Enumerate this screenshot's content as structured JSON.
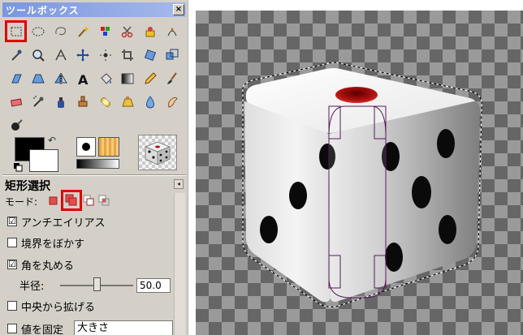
{
  "toolbox": {
    "title": "ツールボックス",
    "close_label": "×",
    "tools": [
      {
        "name": "rect-select-tool-icon",
        "selected": true
      },
      {
        "name": "ellipse-select-tool-icon"
      },
      {
        "name": "free-select-tool-icon"
      },
      {
        "name": "fuzzy-select-tool-icon"
      },
      {
        "name": "color-select-tool-icon"
      },
      {
        "name": "scissors-select-tool-icon"
      },
      {
        "name": "foreground-select-tool-icon"
      },
      {
        "name": "paths-tool-icon"
      },
      {
        "name": "color-picker-tool-icon"
      },
      {
        "name": "zoom-tool-icon"
      },
      {
        "name": "measure-tool-icon"
      },
      {
        "name": "move-tool-icon"
      },
      {
        "name": "align-tool-icon"
      },
      {
        "name": "crop-tool-icon"
      },
      {
        "name": "rotate-tool-icon"
      },
      {
        "name": "scale-tool-icon"
      },
      {
        "name": "shear-tool-icon"
      },
      {
        "name": "perspective-tool-icon"
      },
      {
        "name": "flip-tool-icon"
      },
      {
        "name": "text-tool-icon"
      },
      {
        "name": "bucket-fill-tool-icon"
      },
      {
        "name": "blend-tool-icon"
      },
      {
        "name": "pencil-tool-icon"
      },
      {
        "name": "paintbrush-tool-icon"
      },
      {
        "name": "eraser-tool-icon"
      },
      {
        "name": "airbrush-tool-icon"
      },
      {
        "name": "ink-tool-icon"
      },
      {
        "name": "clone-tool-icon"
      },
      {
        "name": "heal-tool-icon"
      },
      {
        "name": "perspective-clone-tool-icon"
      },
      {
        "name": "blur-tool-icon"
      },
      {
        "name": "smudge-tool-icon"
      },
      {
        "name": "dodge-burn-tool-icon"
      }
    ],
    "text_tool_glyph": "A",
    "colors": {
      "foreground": "#000000",
      "background": "#ffffff",
      "highlight": "#e00000"
    }
  },
  "tool_options": {
    "title": "矩形選択",
    "mode_label": "モード:",
    "mode_selected_index": 1,
    "antialias_label": "アンチエイリアス",
    "antialias_checked": "☑",
    "feather_label": "境界をぼかす",
    "rounded_label": "角を丸める",
    "radius_label": "半径:",
    "radius_value": "50.0",
    "radius_level": 0.5,
    "expand_label": "中央から拡げる",
    "fixed_label": "値を固定",
    "fixed_value": "大きさ"
  }
}
